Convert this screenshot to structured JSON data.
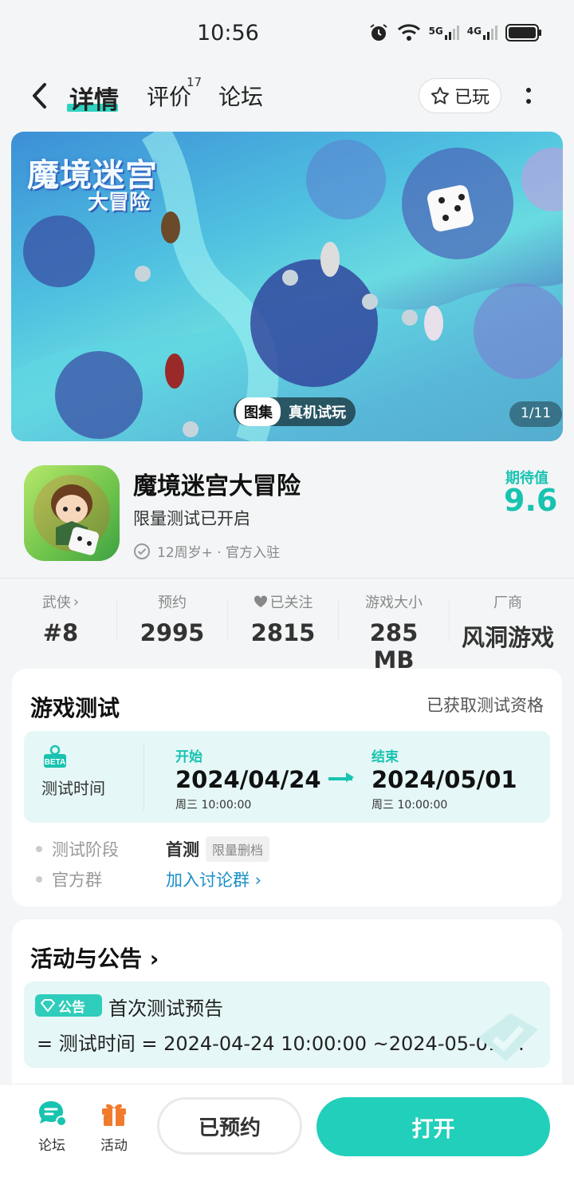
{
  "status_bar": {
    "time": "10:56",
    "icons": [
      "alarm-icon",
      "wifi-icon",
      "5g-signal-icon",
      "4g-signal-icon",
      "battery-icon"
    ],
    "net1": "5G",
    "net2": "4G"
  },
  "header": {
    "tabs": [
      {
        "label": "详情",
        "active": true
      },
      {
        "label": "评价",
        "badge": "17"
      },
      {
        "label": "论坛"
      }
    ],
    "played_label": "已玩"
  },
  "banner": {
    "title": "魔境迷宫",
    "subtitle": "大冒险",
    "gallery_label": "图集",
    "trial_label": "真机试玩",
    "counter": "1/11"
  },
  "game": {
    "name": "魔境迷宫大冒险",
    "tagline": "限量测试已开启",
    "meta": "12周岁+ · 官方入驻",
    "expect_label": "期待值",
    "expect_value": "9.6"
  },
  "stats": [
    {
      "label": "武侠",
      "value": "#8"
    },
    {
      "label": "预约",
      "value": "2995"
    },
    {
      "label": "已关注",
      "value": "2815"
    },
    {
      "label": "游戏大小",
      "value": "285 MB"
    },
    {
      "label": "厂商",
      "value": "风洞游戏"
    }
  ],
  "test_section": {
    "title": "游戏测试",
    "qualification": "已获取测试资格",
    "time_label": "测试时间",
    "start": {
      "label": "开始",
      "date": "2024/04/24",
      "time": "周三  10:00:00"
    },
    "end": {
      "label": "结束",
      "date": "2024/05/01",
      "time": "周三  10:00:00"
    },
    "phase_key": "测试阶段",
    "phase_value": "首测",
    "phase_tag": "限量删档",
    "group_key": "官方群",
    "group_link": "加入讨论群"
  },
  "notice_section": {
    "title": "活动与公告",
    "tag": "公告",
    "notice_title": "首次测试预告",
    "notice_text": "= 测试时间 = 2024-04-24 10:00:00 ~2024-05-01 ..."
  },
  "bottom_bar": {
    "forum_label": "论坛",
    "activity_label": "活动",
    "reserved_label": "已预约",
    "open_label": "打开"
  },
  "colors": {
    "accent": "#22cfba",
    "link": "#1a8fc7",
    "activity": "#f07b2e"
  }
}
